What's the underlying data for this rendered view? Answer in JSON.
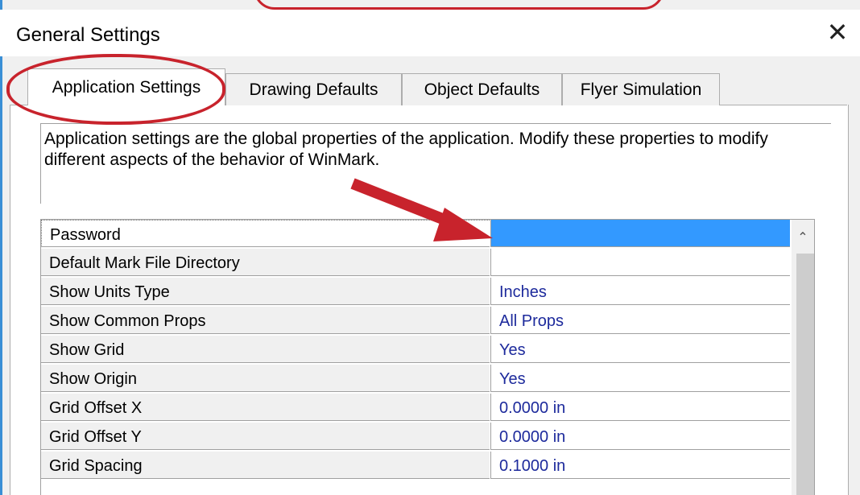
{
  "window": {
    "title": "General Settings"
  },
  "tabs": [
    {
      "label": "Application Settings",
      "active": true
    },
    {
      "label": "Drawing Defaults",
      "active": false
    },
    {
      "label": "Object Defaults",
      "active": false
    },
    {
      "label": "Flyer Simulation",
      "active": false
    }
  ],
  "description": "Application settings are the global properties of the application. Modify these properties to modify different aspects of the behavior of WinMark.",
  "properties": [
    {
      "name": "Password",
      "value": ""
    },
    {
      "name": "Default Mark File Directory",
      "value": ""
    },
    {
      "name": "Show Units Type",
      "value": "Inches"
    },
    {
      "name": "Show Common Props",
      "value": "All Props"
    },
    {
      "name": "Show Grid",
      "value": "Yes"
    },
    {
      "name": "Show Origin",
      "value": "Yes"
    },
    {
      "name": "Grid Offset X",
      "value": "0.0000 in"
    },
    {
      "name": "Grid Offset Y",
      "value": "0.0000 in"
    },
    {
      "name": "Grid Spacing",
      "value": "0.1000 in"
    }
  ],
  "colors": {
    "annotation": "#c8232c",
    "selection": "#3399ff",
    "value_text": "#1d2a9c"
  },
  "icons": {
    "close": "close-icon",
    "scroll_up": "chevron-up-icon"
  }
}
